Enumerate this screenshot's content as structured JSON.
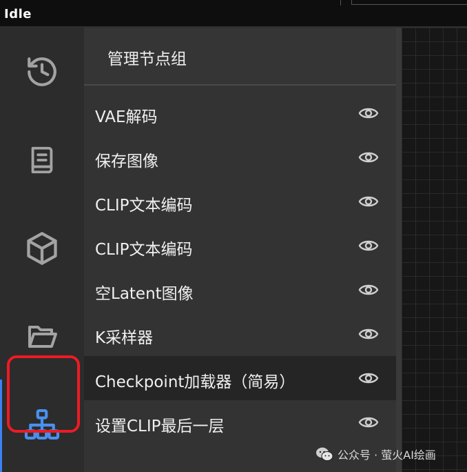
{
  "status": {
    "text": "Idle"
  },
  "sidebar": {
    "items": [
      {
        "icon": "history-icon"
      },
      {
        "icon": "book-icon"
      },
      {
        "icon": "cube-icon"
      },
      {
        "icon": "folder-open-icon"
      },
      {
        "icon": "node-tree-icon",
        "active": true
      }
    ]
  },
  "panel": {
    "title": "管理节点组",
    "nodes": [
      {
        "label": "VAE解码"
      },
      {
        "label": "保存图像"
      },
      {
        "label": "CLIP文本编码"
      },
      {
        "label": "CLIP文本编码"
      },
      {
        "label": "空Latent图像"
      },
      {
        "label": "K采样器"
      },
      {
        "label": "Checkpoint加载器（简易）",
        "selected": true
      },
      {
        "label": "设置CLIP最后一层"
      }
    ]
  },
  "watermark": {
    "text": "公众号 · 萤火AI绘画"
  },
  "colors": {
    "accent": "#3b82f6",
    "highlight": "#ee1b24",
    "panel": "#333333",
    "rail": "#2c2c2c"
  }
}
